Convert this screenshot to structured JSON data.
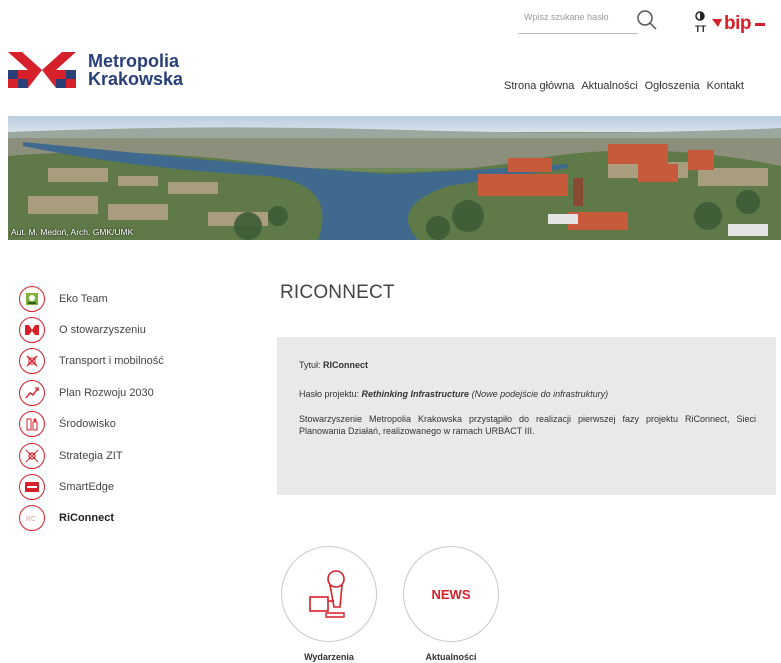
{
  "header": {
    "search_placeholder": "Wpisz szukane hasło",
    "bip_label": "bip",
    "logo": {
      "line1": "Metropolia",
      "line2": "Krakowska"
    },
    "nav": [
      "Strona główna",
      "Aktualności",
      "Ogłoszenia",
      "Kontakt"
    ]
  },
  "banner": {
    "caption": "Aut. M. Medoń, Arch. GMK/UMK"
  },
  "sidebar": {
    "items": [
      {
        "label": "Eko Team",
        "icon": "eko-team-icon"
      },
      {
        "label": "O stowarzyszeniu",
        "icon": "gmk-logo-icon"
      },
      {
        "label": "Transport i mobilność",
        "icon": "transport-icon"
      },
      {
        "label": "Plan Rozwoju 2030",
        "icon": "chart-icon"
      },
      {
        "label": "Środowisko",
        "icon": "environment-icon"
      },
      {
        "label": "Strategia ZIT",
        "icon": "strategy-icon"
      },
      {
        "label": "SmartEdge",
        "icon": "smartedge-icon"
      },
      {
        "label": "RiConnect",
        "icon": "riconnect-icon"
      }
    ],
    "active": "RiConnect"
  },
  "main": {
    "title": "RICONNECT",
    "title_label": "Tytuł:",
    "title_value": "RIConnect",
    "motto_label": "Hasło projektu:",
    "motto_value": "Rethinking Infrastructure",
    "motto_translation": "(Nowe podejście do infrastruktury)",
    "description": "Stowarzyszenie Metropolia Krakowska przystąpiło do realizacji pierwszej fazy projektu RiConnect, Sieci Planowania Działań, realizowanego w ramach URBACT III."
  },
  "tiles": [
    {
      "label": "Wydarzenia",
      "icon": "microphone-icon"
    },
    {
      "label": "Aktualności",
      "icon_text": "NEWS"
    }
  ],
  "colors": {
    "accent": "#d6202a",
    "brand_blue": "#283f78",
    "box_bg": "#e9e9e9"
  }
}
